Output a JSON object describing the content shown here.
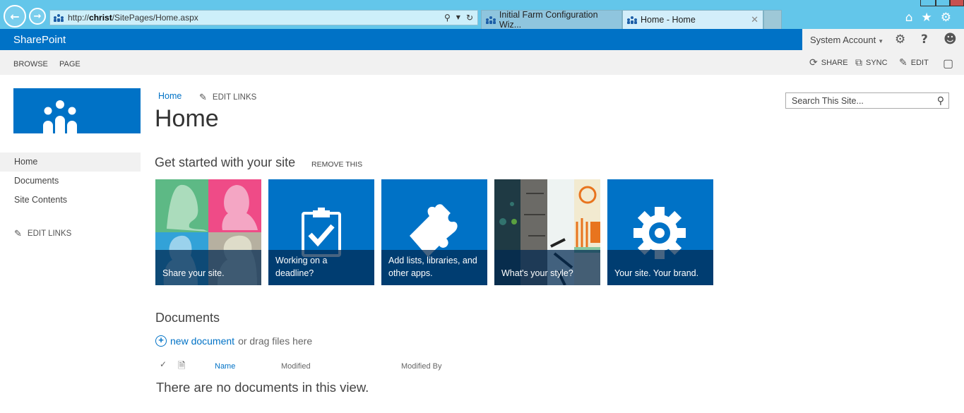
{
  "browser": {
    "address": {
      "prefix": "http://",
      "host": "christ",
      "path": "/SitePages/Home.aspx"
    },
    "tabs": [
      {
        "label": "Initial Farm Configuration Wiz...",
        "active": false
      },
      {
        "label": "Home - Home",
        "active": true
      }
    ],
    "toolbar_icons": [
      "home-icon",
      "favorites-star-icon",
      "tools-gear-icon"
    ]
  },
  "suite_bar": {
    "brand": "SharePoint",
    "account": "System Account",
    "icons": [
      "settings-gear-icon",
      "help-icon",
      "smiley-feedback-icon"
    ]
  },
  "ribbon": {
    "tabs": [
      "BROWSE",
      "PAGE"
    ],
    "actions": [
      {
        "label": "SHARE",
        "icon": "share-icon"
      },
      {
        "label": "SYNC",
        "icon": "sync-icon"
      },
      {
        "label": "EDIT",
        "icon": "pencil-icon"
      }
    ],
    "focus_icon": "focus-on-content-icon"
  },
  "left_nav": {
    "items": [
      {
        "label": "Home",
        "selected": true
      },
      {
        "label": "Documents",
        "selected": false
      },
      {
        "label": "Site Contents",
        "selected": false
      }
    ],
    "edit_links": "EDIT LINKS"
  },
  "top_nav": {
    "link": "Home",
    "edit_links": "EDIT LINKS"
  },
  "page_title": "Home",
  "search": {
    "placeholder": "Search This Site..."
  },
  "get_started": {
    "title": "Get started with your site",
    "remove": "REMOVE THIS",
    "tiles": [
      {
        "caption": "Share your site."
      },
      {
        "caption": "Working on a deadline?"
      },
      {
        "caption": "Add lists, libraries, and other apps."
      },
      {
        "caption": "What's your style?"
      },
      {
        "caption": "Your site. Your brand."
      }
    ]
  },
  "documents": {
    "title": "Documents",
    "new_link": "new document",
    "new_suffix": "or drag files here",
    "columns": [
      "Name",
      "Modified",
      "Modified By"
    ],
    "empty_message": "There are no documents in this view."
  },
  "colors": {
    "brand_blue": "#0072c6",
    "chrome_blue": "#63c6ea",
    "ribbon_gray": "#f1f1f1"
  }
}
